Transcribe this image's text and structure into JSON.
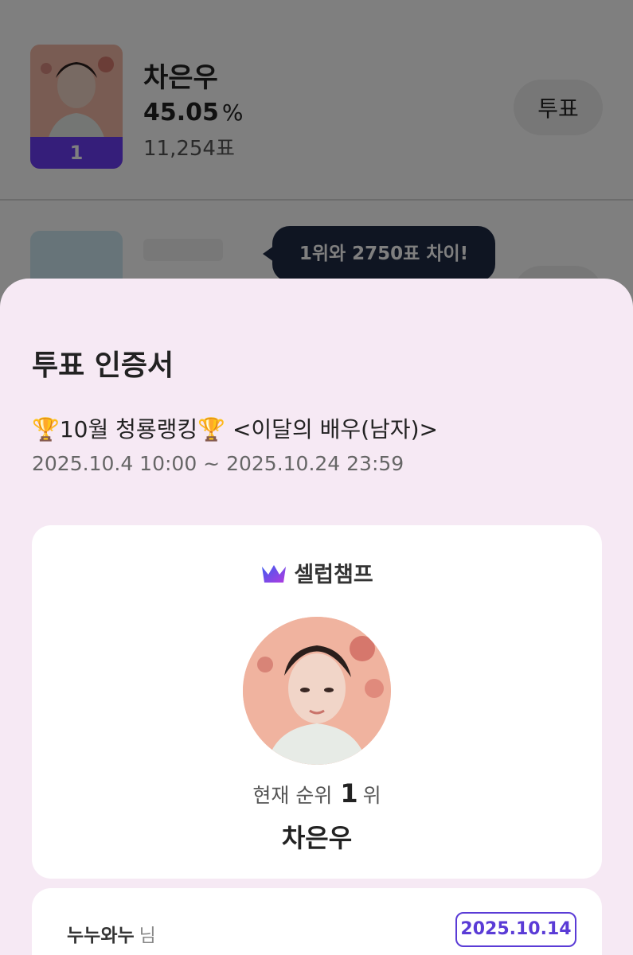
{
  "list": {
    "top_item": {
      "name": "차은우",
      "percent": "45.05",
      "percent_unit": "%",
      "votes": "11,254표",
      "rank": "1",
      "vote_button": "투표"
    },
    "tooltip": "1위와 2750표 차이!"
  },
  "sheet": {
    "title": "투표 인증서",
    "event_title": "🏆10월 청룡랭킹🏆 <이달의 배우(남자)>",
    "event_period": "2025.10.4 10:00 ~ 2025.10.24 23:59",
    "certificate": {
      "brand": "셀럽챔프",
      "rank_label": "현재 순위",
      "rank_value": "1",
      "rank_suffix": "위",
      "name": "차은우"
    },
    "voter": {
      "name": "누누와누",
      "suffix": "님",
      "date": "2025.10.14"
    }
  },
  "colors": {
    "accent": "#6a3df5",
    "sheet_bg": "#f6e9f4",
    "tooltip_bg": "#1f2a44"
  }
}
